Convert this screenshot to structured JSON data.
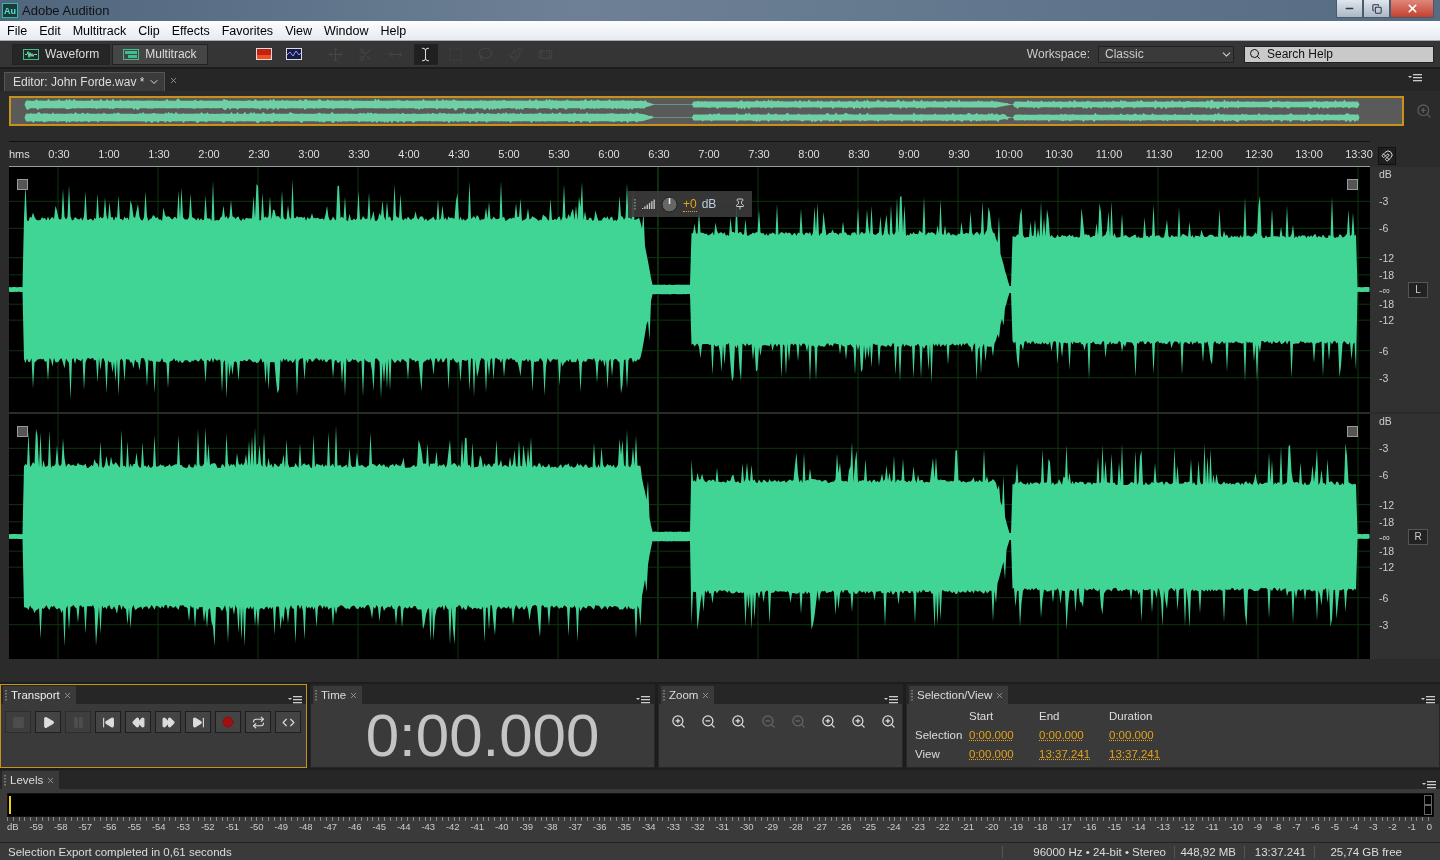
{
  "window": {
    "title": "Adobe Audition",
    "app_icon": "Au"
  },
  "menu": [
    "File",
    "Edit",
    "Multitrack",
    "Clip",
    "Effects",
    "Favorites",
    "View",
    "Window",
    "Help"
  ],
  "modes": [
    {
      "label": "Waveform",
      "selected": true
    },
    {
      "label": "Multitrack",
      "selected": false
    }
  ],
  "tools": [
    {
      "kind": "spectral",
      "selected": false,
      "disabled": false
    },
    {
      "kind": "pitch",
      "selected": false,
      "disabled": false
    },
    {
      "kind": "move",
      "selected": false,
      "disabled": true
    },
    {
      "kind": "razor",
      "selected": false,
      "disabled": true
    },
    {
      "kind": "stretch",
      "selected": false,
      "disabled": true
    },
    {
      "kind": "time",
      "selected": true,
      "disabled": false
    },
    {
      "kind": "marquee",
      "selected": false,
      "disabled": true
    },
    {
      "kind": "lasso",
      "selected": false,
      "disabled": true
    },
    {
      "kind": "brush",
      "selected": false,
      "disabled": true
    },
    {
      "kind": "heal",
      "selected": false,
      "disabled": true
    }
  ],
  "workspace": {
    "label": "Workspace:",
    "value": "Classic"
  },
  "search": {
    "placeholder": "Search Help"
  },
  "editor": {
    "tab": "Editor: John Forde.wav *"
  },
  "ruler": {
    "unit": "hms",
    "ticks": [
      "0:30",
      "1:00",
      "1:30",
      "2:00",
      "2:30",
      "3:00",
      "3:30",
      "4:00",
      "4:30",
      "5:00",
      "5:30",
      "6:00",
      "6:30",
      "7:00",
      "7:30",
      "8:00",
      "8:30",
      "9:00",
      "9:30",
      "10:00",
      "10:30",
      "11:00",
      "11:30",
      "12:00",
      "12:30",
      "13:00",
      "13:30"
    ]
  },
  "channels": [
    {
      "name": "L",
      "scale": [
        "dB",
        "-3",
        "-6",
        "-12",
        "-18",
        "-∞",
        "-18",
        "-12",
        "-6",
        "-3"
      ]
    },
    {
      "name": "R",
      "scale": [
        "dB",
        "-3",
        "-6",
        "-12",
        "-18",
        "-∞",
        "-18",
        "-12",
        "-6",
        "-3"
      ]
    }
  ],
  "hud": {
    "volume": "+0",
    "unit": "dB"
  },
  "transport": {
    "title": "Transport",
    "focused": true,
    "buttons": [
      {
        "kind": "stop",
        "disabled": true
      },
      {
        "kind": "play",
        "disabled": false
      },
      {
        "kind": "pause",
        "disabled": true
      },
      {
        "kind": "start",
        "disabled": false
      },
      {
        "kind": "rewind",
        "disabled": false
      },
      {
        "kind": "forward",
        "disabled": false
      },
      {
        "kind": "end",
        "disabled": false
      },
      {
        "kind": "record",
        "disabled": false
      },
      {
        "kind": "loop",
        "disabled": false
      },
      {
        "kind": "skip",
        "disabled": false
      }
    ]
  },
  "time": {
    "title": "Time",
    "focused": false,
    "value": "0:00.000"
  },
  "zoom": {
    "title": "Zoom",
    "focused": false,
    "tools": [
      {
        "kind": "in",
        "disabled": false
      },
      {
        "kind": "out",
        "disabled": false
      },
      {
        "kind": "in",
        "disabled": false
      },
      {
        "kind": "out",
        "disabled": true
      },
      {
        "kind": "out",
        "disabled": true
      },
      {
        "kind": "in",
        "disabled": false
      },
      {
        "kind": "in",
        "disabled": false
      },
      {
        "kind": "in",
        "disabled": false
      }
    ]
  },
  "selection_view": {
    "title": "Selection/View",
    "focused": false,
    "columns": [
      "Start",
      "End",
      "Duration"
    ],
    "rows": [
      {
        "label": "Selection",
        "values": [
          "0:00.000",
          "0:00.000",
          "0:00.000"
        ]
      },
      {
        "label": "View",
        "values": [
          "0:00.000",
          "13:37.241",
          "13:37.241"
        ]
      }
    ]
  },
  "levels": {
    "title": "Levels",
    "scale": [
      "dB",
      "-59",
      "-58",
      "-57",
      "-56",
      "-55",
      "-54",
      "-53",
      "-52",
      "-51",
      "-50",
      "-49",
      "-48",
      "-47",
      "-46",
      "-45",
      "-44",
      "-43",
      "-42",
      "-41",
      "-40",
      "-39",
      "-38",
      "-37",
      "-36",
      "-35",
      "-34",
      "-33",
      "-32",
      "-31",
      "-30",
      "-29",
      "-28",
      "-27",
      "-26",
      "-25",
      "-24",
      "-23",
      "-22",
      "-21",
      "-20",
      "-19",
      "-18",
      "-17",
      "-16",
      "-15",
      "-14",
      "-13",
      "-12",
      "-11",
      "-10",
      "-9",
      "-8",
      "-7",
      "-6",
      "-5",
      "-4",
      "-3",
      "-2",
      "-1",
      "0"
    ]
  },
  "status": {
    "message": "Selection Export completed in 0,61 seconds",
    "format": "96000 Hz • 24-bit • Stereo",
    "size": "448,92 MB",
    "duration": "13:37.241",
    "free": "25,74 GB free"
  }
}
